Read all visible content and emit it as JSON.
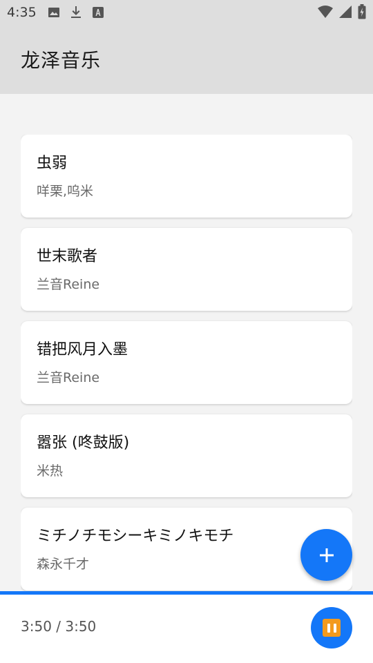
{
  "status_bar": {
    "time": "4:35",
    "left_icons": [
      "image-icon",
      "download-icon",
      "font-icon"
    ],
    "right_icons": [
      "wifi-icon",
      "cell-signal-icon",
      "battery-icon"
    ]
  },
  "app_bar": {
    "title": "龙泽音乐"
  },
  "songs": [
    {
      "title": "虫弱",
      "artist": "咩栗,呜米"
    },
    {
      "title": "世末歌者",
      "artist": "兰音Reine"
    },
    {
      "title": "错把风月入墨",
      "artist": "兰音Reine"
    },
    {
      "title": "嚣张 (咚鼓版)",
      "artist": "米热"
    },
    {
      "title": "ミチノチモシーキミノキモチ",
      "artist": "森永千才"
    }
  ],
  "fab": {
    "icon": "plus-icon"
  },
  "player": {
    "time_display": "3:50 / 3:50",
    "progress": 1.0,
    "play_icon": "pause-icon"
  },
  "colors": {
    "accent": "#1477f8",
    "app_bar_bg": "#dedede",
    "pause_glyph": "#f39a1e"
  }
}
